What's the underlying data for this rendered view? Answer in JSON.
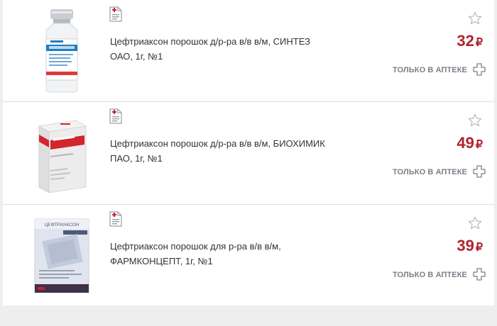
{
  "products": [
    {
      "title_line1": "Цефтриаксон порошок д/р-ра в/в в/м, СИНТЕЗ",
      "title_line2": "ОАО, 1г, №1",
      "price": "32",
      "currency": "₽",
      "availability": "ТОЛЬКО В АПТЕКЕ",
      "image_icon": "vial-icon"
    },
    {
      "title_line1": "Цефтриаксон порошок д/р-ра в/в в/м, БИОХИМИК",
      "title_line2": "ПАО, 1г, №1",
      "price": "49",
      "currency": "₽",
      "availability": "ТОЛЬКО В АПТЕКЕ",
      "image_icon": "box-icon"
    },
    {
      "title_line1": "Цефтриаксон порошок для р-ра в/в в/м,",
      "title_line2": "ФАРМКОНЦЕПТ, 1г, №1",
      "price": "39",
      "currency": "₽",
      "availability": "ТОЛЬКО В АПТЕКЕ",
      "image_icon": "box-icon",
      "box_brand": "ЦЕФТРИАКСОН"
    }
  ],
  "colors": {
    "price": "#b0232e",
    "accent_red": "#c8202e",
    "muted": "#7a8088"
  }
}
